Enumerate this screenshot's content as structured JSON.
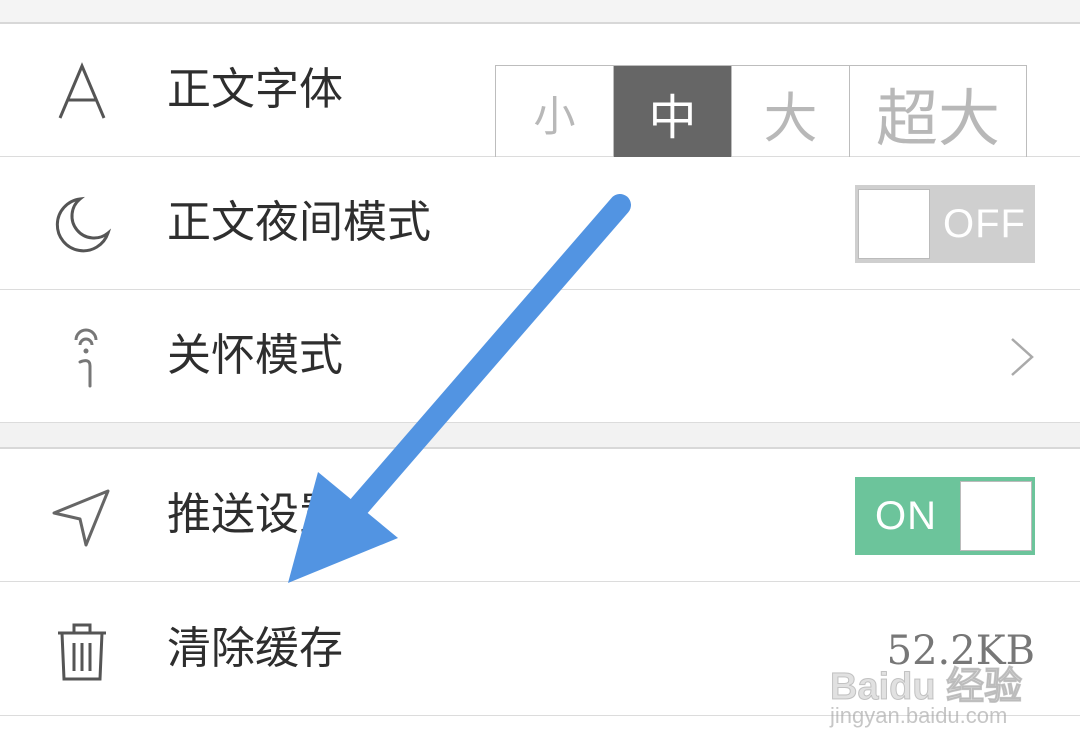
{
  "settings": {
    "font_size": {
      "label": "正文字体",
      "icon": "letter-a-icon",
      "options": [
        "小",
        "中",
        "大",
        "超大"
      ],
      "selected": "中"
    },
    "night_mode": {
      "label": "正文夜间模式",
      "icon": "moon-icon",
      "toggle_label": "OFF",
      "enabled": false
    },
    "care_mode": {
      "label": "关怀模式",
      "icon": "care-person-icon"
    },
    "push": {
      "label": "推送设置",
      "icon": "send-arrow-icon",
      "toggle_label": "ON",
      "enabled": true
    },
    "clear_cache": {
      "label": "清除缓存",
      "icon": "trash-icon",
      "value": "52.2KB"
    }
  },
  "overlay": {
    "arrow_color": "#5294e2",
    "watermark": {
      "logo": "Baidu 经验",
      "url": "jingyan.baidu.com"
    }
  },
  "colors": {
    "toggle_on": "#6cc49b",
    "toggle_off": "#cfcfcf",
    "segment_active": "#666666"
  }
}
